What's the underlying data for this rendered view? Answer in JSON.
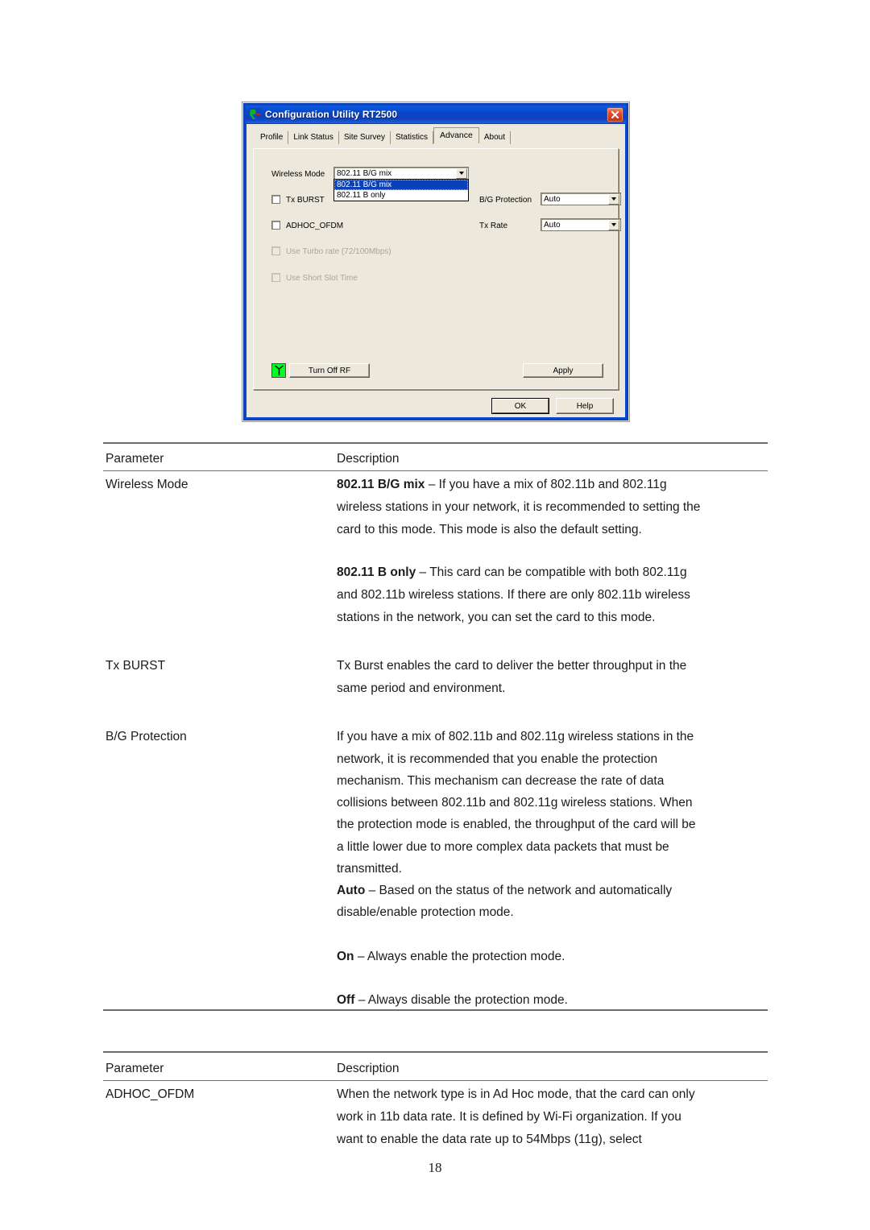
{
  "window": {
    "title": "Configuration Utility RT2500",
    "icon": "ralink-logo-icon",
    "close_label": "✕",
    "tabs": [
      {
        "label": "Profile",
        "active": false
      },
      {
        "label": "Link Status",
        "active": false
      },
      {
        "label": "Site Survey",
        "active": false
      },
      {
        "label": "Statistics",
        "active": false
      },
      {
        "label": "Advance",
        "active": true
      },
      {
        "label": "About",
        "active": false
      }
    ],
    "fields": {
      "wireless_mode_label": "Wireless Mode",
      "wireless_mode_value": "802.11 B/G mix",
      "wireless_mode_options": [
        "802.11 B/G mix",
        "802.11 B only"
      ],
      "wireless_mode_selected_index": 0,
      "tx_burst_label": "Tx BURST",
      "tx_burst_checked": false,
      "adhoc_ofdm_label": "ADHOC_OFDM",
      "adhoc_ofdm_checked": false,
      "turbo_rate_label": "Use Turbo rate (72/100Mbps)",
      "turbo_rate_checked": false,
      "turbo_rate_disabled": true,
      "short_slot_label": "Use Short Slot Time",
      "short_slot_checked": false,
      "short_slot_disabled": true,
      "bg_protection_label": "B/G Protection",
      "bg_protection_value": "Auto",
      "tx_rate_label": "Tx Rate",
      "tx_rate_value": "Auto"
    },
    "buttons": {
      "turn_off_rf": "Turn Off RF",
      "apply": "Apply",
      "ok": "OK",
      "help": "Help"
    },
    "colors": {
      "titlebar": "#0a46c8",
      "dialog_face": "#ece8db",
      "rf_on": "#00ff21",
      "selection": "#0a40b8",
      "close_button": "#e04a24"
    }
  },
  "document": {
    "table1": {
      "header": {
        "parameter": "Parameter",
        "description": "Description"
      },
      "rows": [
        {
          "parameter": "Wireless Mode",
          "lines": [
            {
              "bold": "802.11 B/G mix",
              "rest": " – If you have a mix of 802.11b and 802.11g"
            },
            {
              "bold": "",
              "rest": "wireless stations in your network, it is recommended to setting the"
            },
            {
              "bold": "",
              "rest": "card to this mode. This mode is also the default setting."
            },
            {
              "bold": "",
              "rest": ""
            },
            {
              "bold": "802.11 B only",
              "rest": " – This card can be compatible with both 802.11g"
            },
            {
              "bold": "",
              "rest": "and 802.11b wireless stations. If there are only 802.11b wireless"
            },
            {
              "bold": "",
              "rest": "stations in the network, you can set the card to this mode."
            }
          ]
        },
        {
          "parameter": "Tx BURST",
          "lines": [
            {
              "bold": "",
              "rest": "Tx Burst enables the card to deliver the better throughput in the"
            },
            {
              "bold": "",
              "rest": "same period and environment."
            }
          ]
        },
        {
          "parameter": "B/G Protection",
          "lines": [
            {
              "bold": "",
              "rest": "If you have a mix of 802.11b and 802.11g wireless stations in the"
            },
            {
              "bold": "",
              "rest": "network, it is recommended that you enable the protection"
            },
            {
              "bold": "",
              "rest": "mechanism. This mechanism can decrease the rate of data"
            },
            {
              "bold": "",
              "rest": "collisions between 802.11b and 802.11g wireless stations. When"
            },
            {
              "bold": "",
              "rest": "the protection mode is enabled, the throughput of the card will be"
            },
            {
              "bold": "",
              "rest": "a little lower due to more complex data packets that must be"
            },
            {
              "bold": "",
              "rest": "transmitted."
            },
            {
              "bold": "Auto",
              "rest": " – Based on the status of the network and automatically"
            },
            {
              "bold": "",
              "rest": "disable/enable protection mode."
            },
            {
              "bold": "",
              "rest": ""
            },
            {
              "bold": "On",
              "rest": " – Always enable the protection mode."
            },
            {
              "bold": "",
              "rest": ""
            },
            {
              "bold": "Off",
              "rest": " – Always disable the protection mode."
            }
          ]
        }
      ]
    },
    "table2": {
      "header": {
        "parameter": "Parameter",
        "description": "Description"
      },
      "rows": [
        {
          "parameter": "ADHOC_OFDM",
          "lines": [
            {
              "bold": "",
              "rest": "When the network type is in Ad Hoc mode, that the card can only"
            },
            {
              "bold": "",
              "rest": "work in 11b data rate. It is defined by Wi-Fi organization. If you"
            },
            {
              "bold": "",
              "rest": "want to enable the data rate up to 54Mbps (11g), select"
            }
          ]
        }
      ]
    },
    "page_number": "18"
  }
}
